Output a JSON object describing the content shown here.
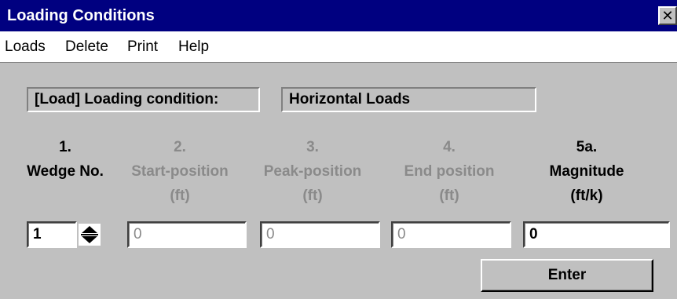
{
  "window": {
    "title": "Loading Conditions",
    "close_glyph": "✕"
  },
  "menu": {
    "items": [
      "Loads",
      "Delete",
      "Print",
      "Help"
    ]
  },
  "condition": {
    "label": "[Load] Loading condition:",
    "value": "Horizontal Loads"
  },
  "columns": [
    {
      "num": "1.",
      "line1": "Wedge No.",
      "line2": ""
    },
    {
      "num": "2.",
      "line1": "Start-position",
      "line2": "(ft)"
    },
    {
      "num": "3.",
      "line1": "Peak-position",
      "line2": "(ft)"
    },
    {
      "num": "4.",
      "line1": "End position",
      "line2": "(ft)"
    },
    {
      "num": "5a.",
      "line1": "Magnitude",
      "line2": "(ft/k)"
    }
  ],
  "inputs": {
    "wedge_no": "1",
    "start_position": "0",
    "peak_position": "0",
    "end_position": "0",
    "magnitude": "0"
  },
  "buttons": {
    "enter": "Enter"
  },
  "icons": {
    "spinner": "spinner-up-down-icon",
    "close": "close-icon"
  },
  "colors": {
    "title_bar": "#000080",
    "window_bg": "#c0c0c0",
    "disabled_text": "#8a8a8a"
  }
}
